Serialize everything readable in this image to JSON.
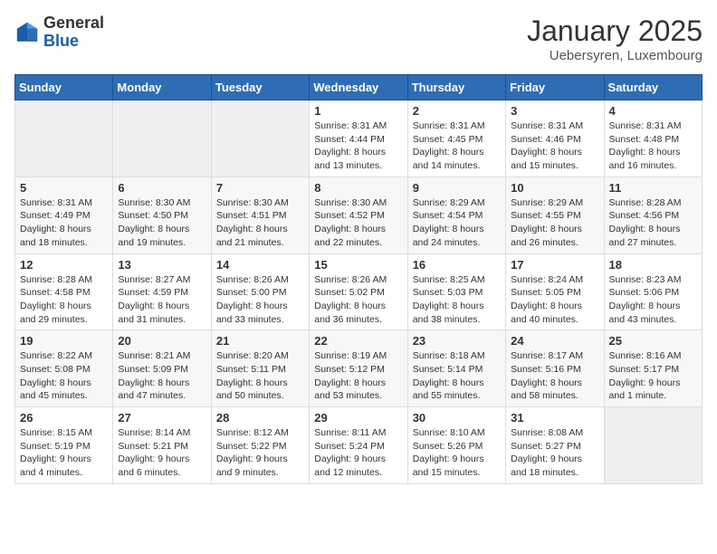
{
  "logo": {
    "general": "General",
    "blue": "Blue"
  },
  "title": "January 2025",
  "location": "Uebersyren, Luxembourg",
  "weekdays": [
    "Sunday",
    "Monday",
    "Tuesday",
    "Wednesday",
    "Thursday",
    "Friday",
    "Saturday"
  ],
  "weeks": [
    [
      {
        "day": "",
        "info": ""
      },
      {
        "day": "",
        "info": ""
      },
      {
        "day": "",
        "info": ""
      },
      {
        "day": "1",
        "info": "Sunrise: 8:31 AM\nSunset: 4:44 PM\nDaylight: 8 hours\nand 13 minutes."
      },
      {
        "day": "2",
        "info": "Sunrise: 8:31 AM\nSunset: 4:45 PM\nDaylight: 8 hours\nand 14 minutes."
      },
      {
        "day": "3",
        "info": "Sunrise: 8:31 AM\nSunset: 4:46 PM\nDaylight: 8 hours\nand 15 minutes."
      },
      {
        "day": "4",
        "info": "Sunrise: 8:31 AM\nSunset: 4:48 PM\nDaylight: 8 hours\nand 16 minutes."
      }
    ],
    [
      {
        "day": "5",
        "info": "Sunrise: 8:31 AM\nSunset: 4:49 PM\nDaylight: 8 hours\nand 18 minutes."
      },
      {
        "day": "6",
        "info": "Sunrise: 8:30 AM\nSunset: 4:50 PM\nDaylight: 8 hours\nand 19 minutes."
      },
      {
        "day": "7",
        "info": "Sunrise: 8:30 AM\nSunset: 4:51 PM\nDaylight: 8 hours\nand 21 minutes."
      },
      {
        "day": "8",
        "info": "Sunrise: 8:30 AM\nSunset: 4:52 PM\nDaylight: 8 hours\nand 22 minutes."
      },
      {
        "day": "9",
        "info": "Sunrise: 8:29 AM\nSunset: 4:54 PM\nDaylight: 8 hours\nand 24 minutes."
      },
      {
        "day": "10",
        "info": "Sunrise: 8:29 AM\nSunset: 4:55 PM\nDaylight: 8 hours\nand 26 minutes."
      },
      {
        "day": "11",
        "info": "Sunrise: 8:28 AM\nSunset: 4:56 PM\nDaylight: 8 hours\nand 27 minutes."
      }
    ],
    [
      {
        "day": "12",
        "info": "Sunrise: 8:28 AM\nSunset: 4:58 PM\nDaylight: 8 hours\nand 29 minutes."
      },
      {
        "day": "13",
        "info": "Sunrise: 8:27 AM\nSunset: 4:59 PM\nDaylight: 8 hours\nand 31 minutes."
      },
      {
        "day": "14",
        "info": "Sunrise: 8:26 AM\nSunset: 5:00 PM\nDaylight: 8 hours\nand 33 minutes."
      },
      {
        "day": "15",
        "info": "Sunrise: 8:26 AM\nSunset: 5:02 PM\nDaylight: 8 hours\nand 36 minutes."
      },
      {
        "day": "16",
        "info": "Sunrise: 8:25 AM\nSunset: 5:03 PM\nDaylight: 8 hours\nand 38 minutes."
      },
      {
        "day": "17",
        "info": "Sunrise: 8:24 AM\nSunset: 5:05 PM\nDaylight: 8 hours\nand 40 minutes."
      },
      {
        "day": "18",
        "info": "Sunrise: 8:23 AM\nSunset: 5:06 PM\nDaylight: 8 hours\nand 43 minutes."
      }
    ],
    [
      {
        "day": "19",
        "info": "Sunrise: 8:22 AM\nSunset: 5:08 PM\nDaylight: 8 hours\nand 45 minutes."
      },
      {
        "day": "20",
        "info": "Sunrise: 8:21 AM\nSunset: 5:09 PM\nDaylight: 8 hours\nand 47 minutes."
      },
      {
        "day": "21",
        "info": "Sunrise: 8:20 AM\nSunset: 5:11 PM\nDaylight: 8 hours\nand 50 minutes."
      },
      {
        "day": "22",
        "info": "Sunrise: 8:19 AM\nSunset: 5:12 PM\nDaylight: 8 hours\nand 53 minutes."
      },
      {
        "day": "23",
        "info": "Sunrise: 8:18 AM\nSunset: 5:14 PM\nDaylight: 8 hours\nand 55 minutes."
      },
      {
        "day": "24",
        "info": "Sunrise: 8:17 AM\nSunset: 5:16 PM\nDaylight: 8 hours\nand 58 minutes."
      },
      {
        "day": "25",
        "info": "Sunrise: 8:16 AM\nSunset: 5:17 PM\nDaylight: 9 hours\nand 1 minute."
      }
    ],
    [
      {
        "day": "26",
        "info": "Sunrise: 8:15 AM\nSunset: 5:19 PM\nDaylight: 9 hours\nand 4 minutes."
      },
      {
        "day": "27",
        "info": "Sunrise: 8:14 AM\nSunset: 5:21 PM\nDaylight: 9 hours\nand 6 minutes."
      },
      {
        "day": "28",
        "info": "Sunrise: 8:12 AM\nSunset: 5:22 PM\nDaylight: 9 hours\nand 9 minutes."
      },
      {
        "day": "29",
        "info": "Sunrise: 8:11 AM\nSunset: 5:24 PM\nDaylight: 9 hours\nand 12 minutes."
      },
      {
        "day": "30",
        "info": "Sunrise: 8:10 AM\nSunset: 5:26 PM\nDaylight: 9 hours\nand 15 minutes."
      },
      {
        "day": "31",
        "info": "Sunrise: 8:08 AM\nSunset: 5:27 PM\nDaylight: 9 hours\nand 18 minutes."
      },
      {
        "day": "",
        "info": ""
      }
    ]
  ]
}
